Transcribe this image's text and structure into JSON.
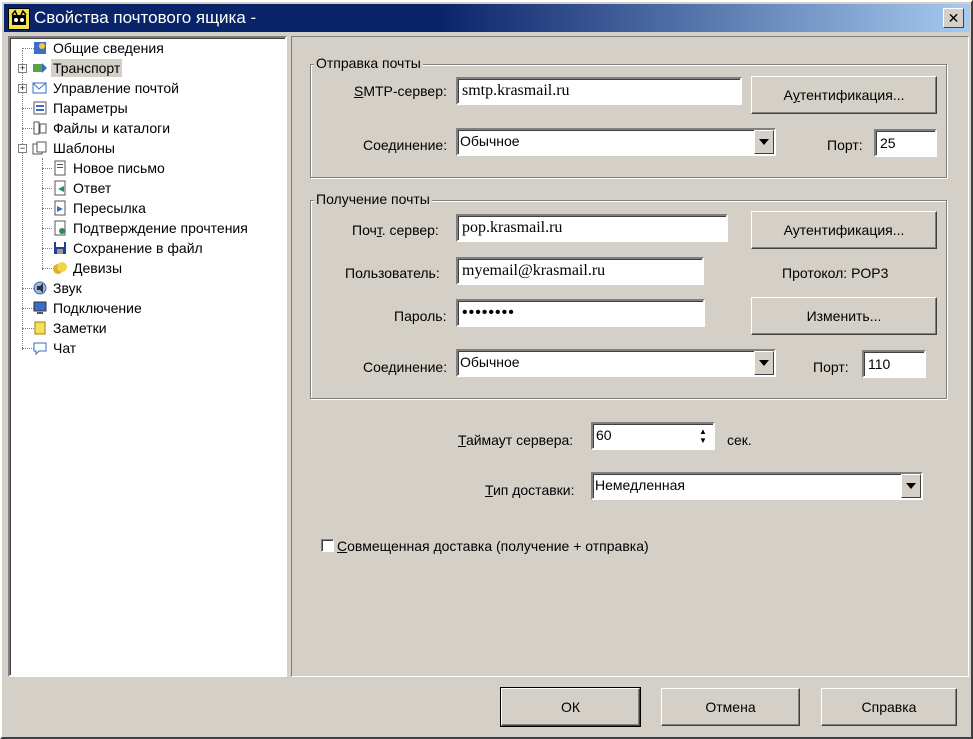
{
  "window": {
    "title": "Свойства почтового ящика -",
    "close_glyph": "✕"
  },
  "tree": {
    "items": [
      {
        "label": "Общие сведения",
        "icon": "info-icon"
      },
      {
        "label": "Транспорт",
        "icon": "transport-icon",
        "expander": "+",
        "selected": true
      },
      {
        "label": "Управление почтой",
        "icon": "mail-management-icon",
        "expander": "+"
      },
      {
        "label": "Параметры",
        "icon": "parameters-icon"
      },
      {
        "label": "Файлы и каталоги",
        "icon": "files-folders-icon"
      },
      {
        "label": "Шаблоны",
        "icon": "templates-icon",
        "expander": "−"
      },
      {
        "label": "Новое письмо",
        "icon": "new-letter-icon"
      },
      {
        "label": "Ответ",
        "icon": "reply-icon"
      },
      {
        "label": "Пересылка",
        "icon": "forward-icon"
      },
      {
        "label": "Подтверждение прочтения",
        "icon": "read-receipt-icon"
      },
      {
        "label": "Сохранение в файл",
        "icon": "save-to-file-icon"
      },
      {
        "label": "Девизы",
        "icon": "mottos-icon"
      },
      {
        "label": "Звук",
        "icon": "sound-icon"
      },
      {
        "label": "Подключение",
        "icon": "connection-icon"
      },
      {
        "label": "Заметки",
        "icon": "notes-icon"
      },
      {
        "label": "Чат",
        "icon": "chat-icon"
      }
    ]
  },
  "send": {
    "legend": "Отправка почты",
    "smtp_label_pre": "S",
    "smtp_label_post": "MTP-сервер:",
    "smtp_value": "smtp.krasmail.ru",
    "auth_button_pre": "А",
    "auth_button_u": "у",
    "auth_button_post": "тентификация...",
    "connection_label": "Соединение:",
    "connection_value": "Обычное",
    "port_label": "Порт:",
    "port_value": "25"
  },
  "receive": {
    "legend": "Получение почты",
    "server_label_pre": "Поч",
    "server_label_u": "т",
    "server_label_post": ". сервер:",
    "server_value": "pop.krasmail.ru",
    "auth_button": "Аутентификация...",
    "user_label": "Пользователь:",
    "user_value": "myemail@krasmail.ru",
    "protocol_text": "Протокол:  POP3",
    "password_label": "Пароль:",
    "password_value": "••••••••",
    "change_button": "Изменить...",
    "connection_label": "Соединение:",
    "connection_value": "Обычное",
    "port_label": "Порт:",
    "port_value": "110"
  },
  "timeout": {
    "label_u": "Т",
    "label_post": "аймаут сервера:",
    "value": "60",
    "unit": "сек."
  },
  "delivery": {
    "label_u": "Т",
    "label_post": "ип доставки:",
    "value": "Немедленная"
  },
  "combined": {
    "checked": false,
    "label_u": "С",
    "label_post": "овмещенная доставка (получение + отправка)"
  },
  "buttons": {
    "ok": "ОК",
    "cancel": "Отмена",
    "help": "Справка"
  }
}
